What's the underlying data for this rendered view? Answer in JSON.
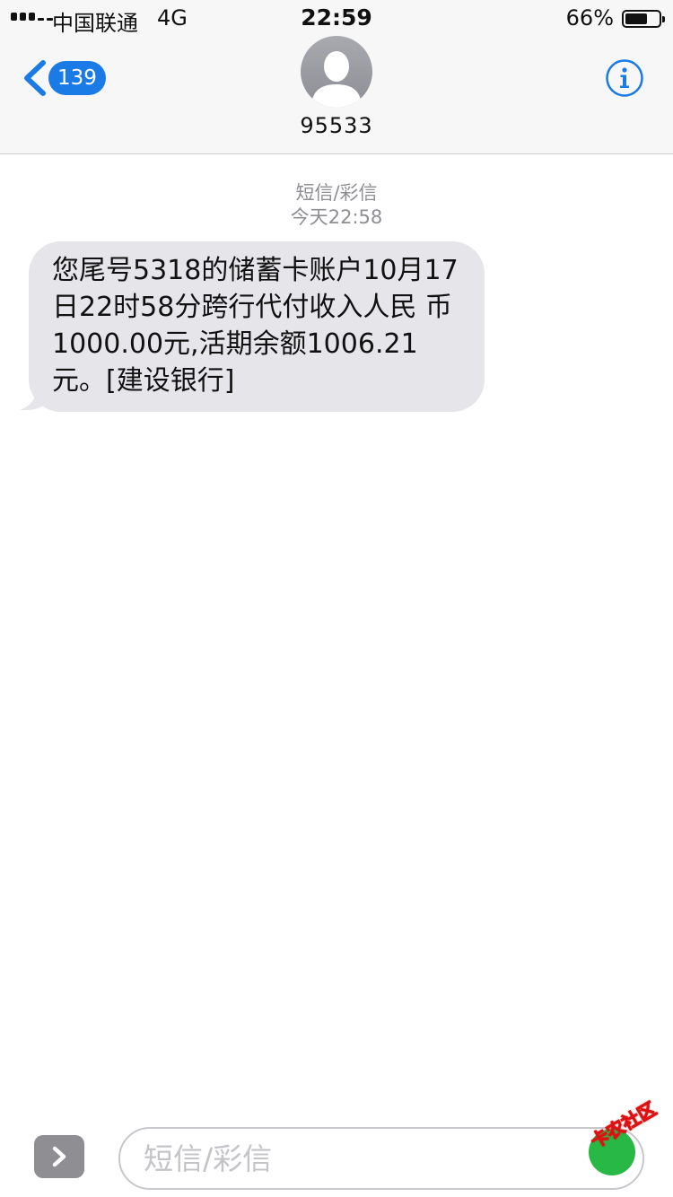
{
  "status_bar": {
    "carrier": "中国联通",
    "network": "4G",
    "time": "22:59",
    "battery_percent": "66%",
    "battery_level": 0.66
  },
  "nav": {
    "back_count": "139",
    "contact_name": "95533",
    "info_icon": "info-icon",
    "back_icon": "chevron-left-icon",
    "avatar_icon": "person-silhouette-icon",
    "accent_color": "#1a7ae6"
  },
  "conversation": {
    "message_type": "短信/彩信",
    "timestamp": "今天22:58",
    "messages": [
      {
        "direction": "incoming",
        "text": "您尾号5318的储蓄卡账户10月17日22时58分跨行代付收入人民 币1000.00元,活期余额1006.21元。[建设银行]",
        "bubble_color": "#e5e5ea"
      }
    ]
  },
  "input_bar": {
    "placeholder": "短信/彩信",
    "expand_icon": "chevron-right-icon"
  },
  "watermark": {
    "text": "卡农社区"
  }
}
